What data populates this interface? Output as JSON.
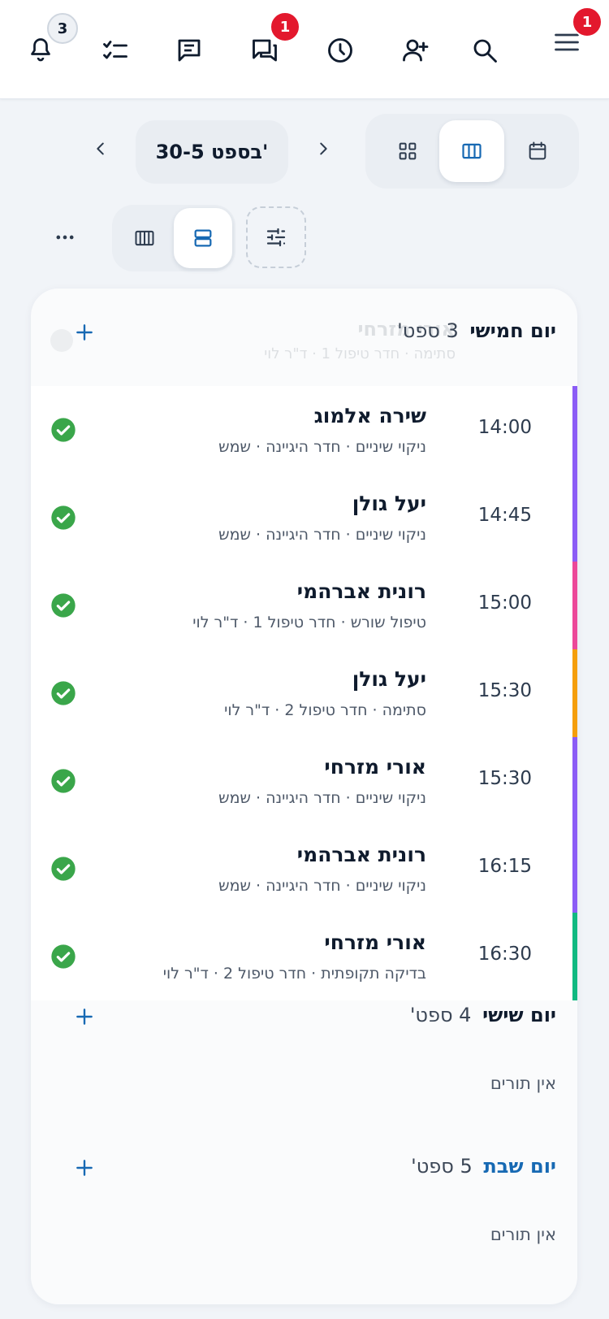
{
  "topbar": {
    "badges": {
      "notifications": "3",
      "messages": "1",
      "menu": "1"
    }
  },
  "nav": {
    "range_label": "30-5 בספט'"
  },
  "days": [
    {
      "name": "יום חמישי",
      "date": "3 ספט'",
      "ghost_name": "אורי מזרחי",
      "ghost_meta": "סתימה · חדר טיפול 1 · ד\"ר לוי"
    },
    {
      "name": "יום שישי",
      "date": "4 ספט'",
      "empty": "אין תורים"
    },
    {
      "name": "יום שבת",
      "date": "5 ספט'",
      "empty": "אין תורים"
    }
  ],
  "appointments": [
    {
      "time": "14:00",
      "name": "שירה אלמוג",
      "meta": "ניקוי שיניים · חדר היגיינה · שמש",
      "color": "#8b5cf6"
    },
    {
      "time": "14:45",
      "name": "יעל גולן",
      "meta": "ניקוי שיניים · חדר היגיינה · שמש",
      "color": "#8b5cf6"
    },
    {
      "time": "15:00",
      "name": "רונית אברהמי",
      "meta": "טיפול שורש · חדר טיפול 1 · ד\"ר לוי",
      "color": "#ec4899"
    },
    {
      "time": "15:30",
      "name": "יעל גולן",
      "meta": "סתימה · חדר טיפול 2 · ד\"ר לוי",
      "color": "#f59e0b"
    },
    {
      "time": "15:30",
      "name": "אורי מזרחי",
      "meta": "ניקוי שיניים · חדר היגיינה · שמש",
      "color": "#8b5cf6"
    },
    {
      "time": "16:15",
      "name": "רונית אברהמי",
      "meta": "ניקוי שיניים · חדר היגיינה · שמש",
      "color": "#8b5cf6"
    },
    {
      "time": "16:30",
      "name": "אורי מזרחי",
      "meta": "בדיקה תקופתית · חדר טיפול 2 · ד\"ר לוי",
      "color": "#10b981"
    }
  ],
  "colors": {
    "accent": "#1769b3",
    "success": "#3aa64a",
    "badge": "#e3182d"
  }
}
